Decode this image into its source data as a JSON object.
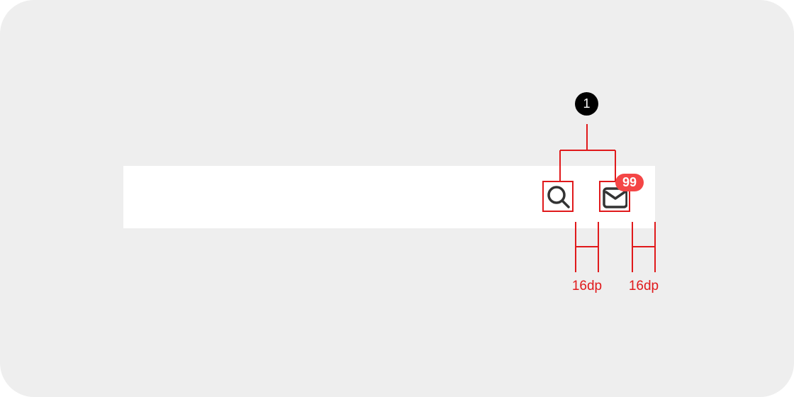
{
  "annotation": {
    "marker_number": "1"
  },
  "app_bar": {
    "actions": [
      {
        "icon": "search-icon"
      },
      {
        "icon": "mail-icon",
        "badge": "99"
      }
    ]
  },
  "spacing_specs": [
    {
      "label": "16dp"
    },
    {
      "label": "16dp"
    }
  ],
  "colors": {
    "background": "#eeeeee",
    "app_bar": "#ffffff",
    "spec_red": "#e0191b",
    "badge": "#f44646",
    "icon": "#333333",
    "marker": "#000000"
  }
}
